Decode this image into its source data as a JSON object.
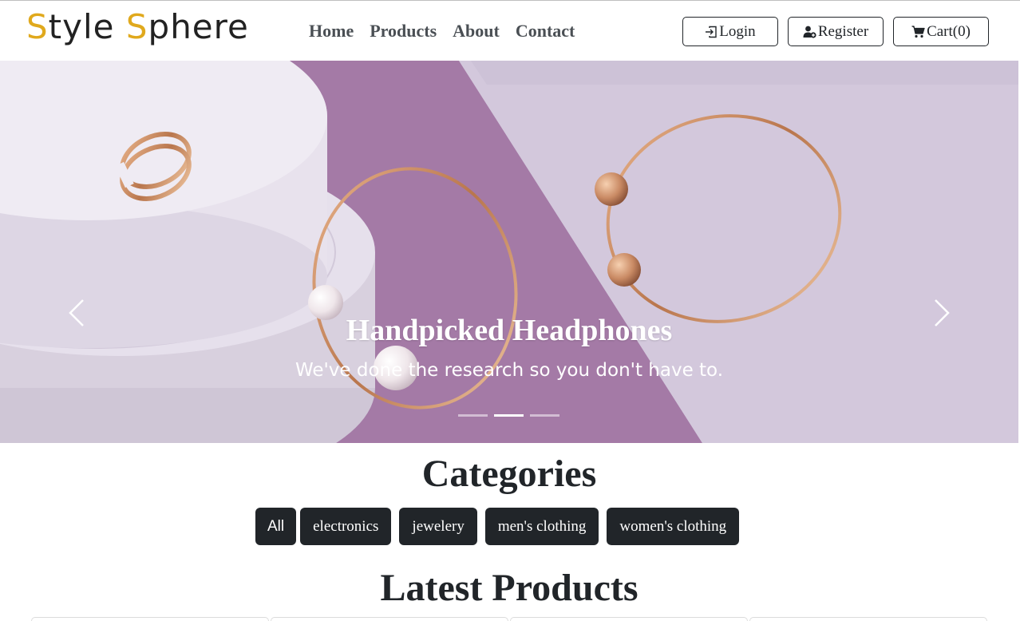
{
  "brand": {
    "part1_accent": "S",
    "part1_rest": "tyle ",
    "part2_accent": "S",
    "part2_rest": "phere",
    "accent_color": "#e0a91d"
  },
  "nav": {
    "links": [
      "Home",
      "Products",
      "About",
      "Contact"
    ],
    "login_label": "Login",
    "register_label": "Register",
    "cart_label": "Cart(0)"
  },
  "carousel": {
    "title": "Handpicked Headphones",
    "subtitle": "We've done the research so you don't have to.",
    "slide_count": 3,
    "active_index": 1,
    "prev_icon": "chevron-left-icon",
    "next_icon": "chevron-right-icon"
  },
  "categories": {
    "title": "Categories",
    "items": [
      "All",
      "electronics",
      "jewelery",
      "men's clothing",
      "women's clothing"
    ]
  },
  "latest": {
    "title": "Latest Products"
  },
  "colors": {
    "dark": "#212529",
    "slide_purple": "#a479a6",
    "slide_lavender": "#d7cde0"
  }
}
